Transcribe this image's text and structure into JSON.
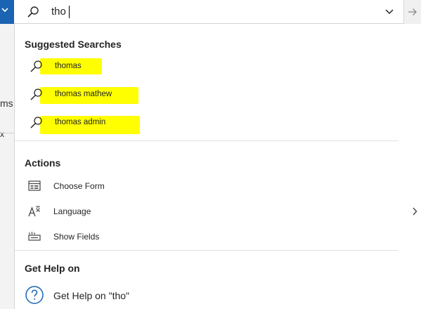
{
  "background": {
    "partial_text": "ms",
    "partial_mark": "x"
  },
  "search": {
    "query": "tho"
  },
  "suggested": {
    "title": "Suggested Searches",
    "items": [
      "thomas",
      "thomas mathew",
      "thomas admin"
    ],
    "highlight_color": "#ffff00"
  },
  "actions": {
    "title": "Actions",
    "items": [
      {
        "label": "Choose Form",
        "icon": "form-icon"
      },
      {
        "label": "Language",
        "icon": "language-icon",
        "has_submenu": true
      },
      {
        "label": "Show Fields",
        "icon": "fields-icon"
      }
    ]
  },
  "help": {
    "title": "Get Help on",
    "item_label": "Get Help on \"tho\"",
    "icon": "help-icon"
  },
  "colors": {
    "accent": "#1b63b3",
    "panel_bg": "#ffffff"
  }
}
